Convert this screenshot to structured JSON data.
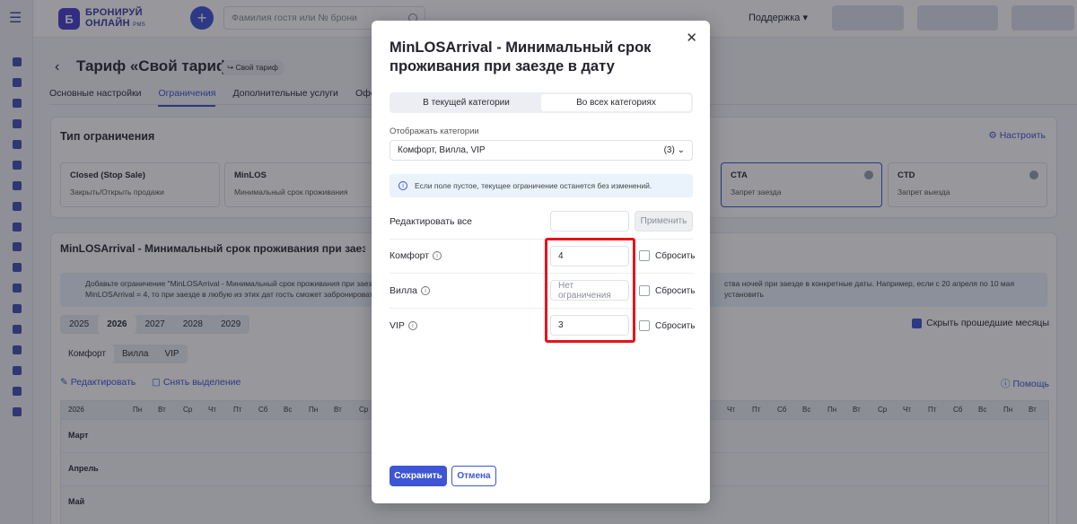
{
  "app": {
    "logo_line1": "БРОНИРУЙ",
    "logo_line2": "ОНЛАЙН",
    "logo_suffix": "PMS",
    "search_placeholder": "Фамилия гостя или № брони",
    "support_label": "Поддержка",
    "sidebar_icons": [
      "house-icon",
      "calendar-icon",
      "user-icon",
      "percent-icon",
      "tag-icon",
      "document-icon",
      "layers-icon",
      "chart-icon",
      "check-icon",
      "key-icon",
      "tick-icon",
      "gear-icon",
      "box-icon",
      "wallet-icon",
      "cashbox-icon",
      "cloud-icon",
      "megaphone-icon",
      "person-icon"
    ]
  },
  "page": {
    "title": "Тариф «Свой тариф»",
    "tag": "Свой тариф",
    "tabs": [
      "Основные настройки",
      "Ограничения",
      "Дополнительные услуги",
      "Оформле"
    ]
  },
  "restrictions": {
    "title": "Тип ограничения",
    "configure_label": "Настроить",
    "types": [
      {
        "name": "Closed (Stop Sale)",
        "desc": "Закрыть/Открыть продажи"
      },
      {
        "name": "MinLOS",
        "desc": "Минимальный срок проживания"
      },
      {
        "name": "CTA",
        "desc": "Запрет заезда"
      },
      {
        "name": "CTD",
        "desc": "Запрет выезда"
      }
    ]
  },
  "calendar_section": {
    "title": "MinLOSArrival - Минимальный срок проживания при заезде в д",
    "info_left": "Добавьте ограничение \"MinLOSArrival - Минимальный срок проживания при заезде в д",
    "info_left2": "MinLOSArrival = 4, то при заезде в любую из этих дат гость сможет забронировать про",
    "info_right": "ства ночей при заезде в конкретные даты. Например, если с 20 апреля по 10 мая установить",
    "years": [
      "2025",
      "2026",
      "2027",
      "2028",
      "2029"
    ],
    "categories": [
      "Комфорт",
      "Вилла",
      "VIP"
    ],
    "hide_past_label": "Скрыть прошедшие месяцы",
    "edit_label": "Редактировать",
    "clear_selection_label": "Снять выделение",
    "help_label": "Помощь",
    "year_label": "2026",
    "weekday_headers_left": [
      "Пн",
      "Вт",
      "Ср",
      "Чт",
      "Пт",
      "Сб",
      "Вс",
      "Пн",
      "Вт",
      "Ср"
    ],
    "weekday_headers_right": [
      "р",
      "Чт",
      "Пт",
      "Сб",
      "Вс",
      "Пн",
      "Вт",
      "Ср",
      "Чт",
      "Пт",
      "Сб",
      "Вс",
      "Пн",
      "Вт"
    ],
    "months": [
      "Март",
      "Апрель",
      "Май"
    ]
  },
  "modal": {
    "title": "MinLOSArrival - Минимальный срок проживания при заезде в дату",
    "segment": [
      "В текущей категории",
      "Во всех категориях"
    ],
    "show_categories_label": "Отображать категории",
    "categories_value": "Комфорт, Вилла, VIP",
    "categories_count": "(3)",
    "info": "Если поле пустое, текущее ограничение останется без изменений.",
    "edit_all_label": "Редактировать все",
    "apply_label": "Применить",
    "rows": [
      {
        "label": "Комфорт",
        "value": "4",
        "placeholder": "",
        "reset": "Сбросить"
      },
      {
        "label": "Вилла",
        "value": "",
        "placeholder": "Нет ограничения",
        "reset": "Сбросить"
      },
      {
        "label": "VIP",
        "value": "3",
        "placeholder": "",
        "reset": "Сбросить"
      }
    ],
    "save_label": "Сохранить",
    "cancel_label": "Отмена"
  }
}
